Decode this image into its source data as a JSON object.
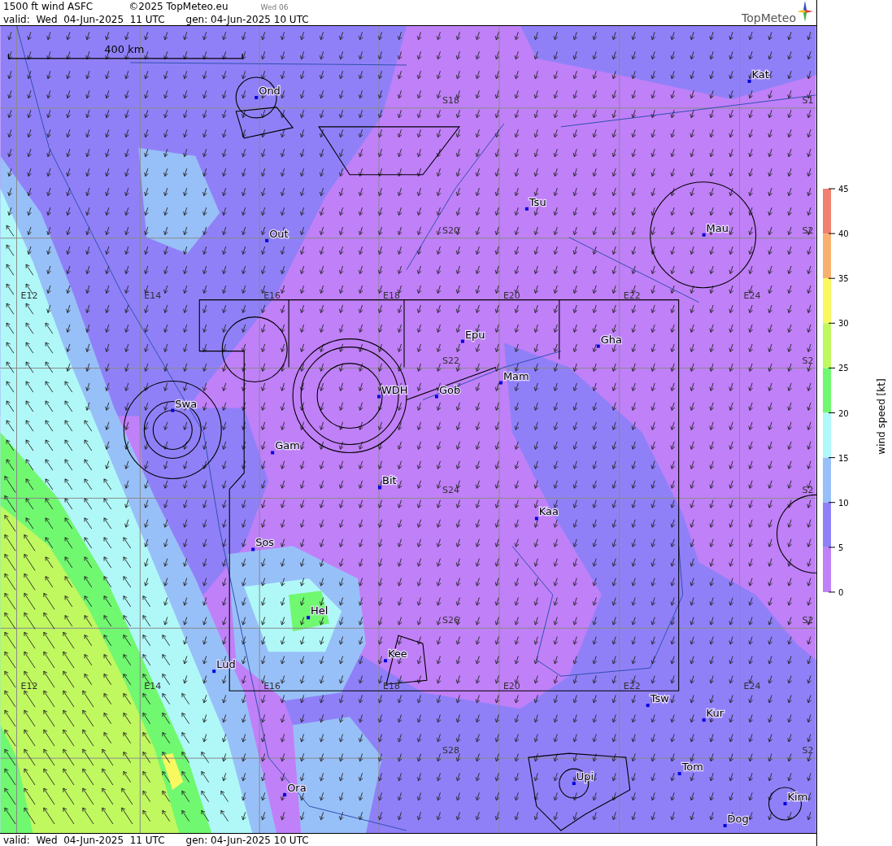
{
  "header": {
    "title": "1500 ft wind ASFC",
    "copyright": "©2025 TopMeteo.eu",
    "day": "Wed 06",
    "valid": "valid:  Wed  04-Jun-2025  11 UTC",
    "generated": "gen: 04-Jun-2025 10 UTC",
    "logo": "TopMeteo"
  },
  "map": {
    "scale_label": "400 km",
    "longitude_labels_top": [
      "E12",
      "E14",
      "E16",
      "E18",
      "E20",
      "E22",
      "E24"
    ],
    "longitude_labels_bottom": [
      "E12",
      "E14",
      "E16",
      "E18",
      "E20",
      "E22",
      "E24"
    ],
    "latitude_labels": [
      "S18",
      "S20",
      "S22",
      "S24",
      "S26",
      "S28"
    ],
    "latitude_labels_edge": [
      "S1",
      "S2",
      "S2",
      "S2",
      "S2",
      "S2"
    ],
    "places": [
      {
        "name": "Ond"
      },
      {
        "name": "Kat"
      },
      {
        "name": "Tsu"
      },
      {
        "name": "Out"
      },
      {
        "name": "Mau"
      },
      {
        "name": "Epu"
      },
      {
        "name": "Gha"
      },
      {
        "name": "Mam"
      },
      {
        "name": "WDH"
      },
      {
        "name": "Gob"
      },
      {
        "name": "Swa"
      },
      {
        "name": "Gam"
      },
      {
        "name": "Bit"
      },
      {
        "name": "Kaa"
      },
      {
        "name": "Sos"
      },
      {
        "name": "Hel"
      },
      {
        "name": "Kee"
      },
      {
        "name": "Lud"
      },
      {
        "name": "Tsw"
      },
      {
        "name": "Kur"
      },
      {
        "name": "Tom"
      },
      {
        "name": "Upi"
      },
      {
        "name": "Ora"
      },
      {
        "name": "Kim"
      },
      {
        "name": "Dog"
      }
    ]
  },
  "legend": {
    "title": "wind speed [kt]",
    "ticks": [
      "45",
      "40",
      "35",
      "30",
      "25",
      "20",
      "15",
      "10",
      "5",
      "0"
    ],
    "bands": [
      {
        "color": "#f08070"
      },
      {
        "color": "#f8b070"
      },
      {
        "color": "#f8f860"
      },
      {
        "color": "#c0f860"
      },
      {
        "color": "#70f870"
      },
      {
        "color": "#b0f8f8"
      },
      {
        "color": "#98c0f8"
      },
      {
        "color": "#9080f8"
      },
      {
        "color": "#c080f8"
      }
    ]
  },
  "footer": {
    "valid": "valid:  Wed  04-Jun-2025  11 UTC",
    "generated": "gen: 04-Jun-2025 10 UTC"
  }
}
